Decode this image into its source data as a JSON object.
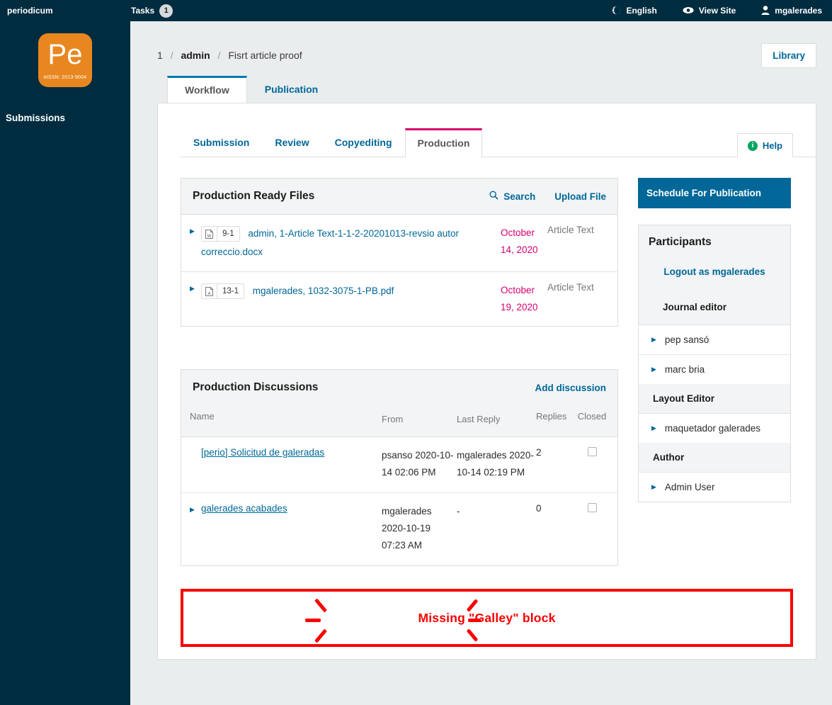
{
  "topbar": {
    "brand": "periodicum",
    "tasks_label": "Tasks",
    "tasks_count": "1",
    "language": "English",
    "language_icon": "globe-icon",
    "view_site": "View Site",
    "view_site_icon": "eye-icon",
    "user": "mgalerades",
    "user_icon": "user-icon"
  },
  "sidebar": {
    "logo_text": "Pe",
    "logo_issn": "eISSN: 2013-9004",
    "nav_label": "Submissions",
    "background": "#002c40",
    "logo_color": "#e8871f"
  },
  "breadcrumb": {
    "id": "1",
    "sep": "/",
    "owner": "admin",
    "title": "Fisrt article proof"
  },
  "library_button": "Library",
  "outer_tabs": [
    {
      "label": "Workflow",
      "active": true
    },
    {
      "label": "Publication",
      "active": false
    }
  ],
  "inner_tabs": [
    {
      "label": "Submission",
      "active": false
    },
    {
      "label": "Review",
      "active": false
    },
    {
      "label": "Copyediting",
      "active": false
    },
    {
      "label": "Production",
      "active": true
    }
  ],
  "help": {
    "label": "Help",
    "icon": "info-icon",
    "icon_color": "#00a65e"
  },
  "production_files": {
    "title": "Production Ready Files",
    "search_label": "Search",
    "search_icon": "search-icon",
    "upload_label": "Upload File",
    "rows": [
      {
        "file_icon": "word-doc-icon",
        "revision": "9-1",
        "name": "admin, 1-Article Text-1-1-2-20201013-revsio autor correccio.docx",
        "date": "October 14, 2020",
        "genre": "Article Text"
      },
      {
        "file_icon": "pdf-doc-icon",
        "revision": "13-1",
        "name": "mgalerades, 1032-3075-1-PB.pdf",
        "date": "October 19, 2020",
        "genre": "Article Text"
      }
    ]
  },
  "discussions": {
    "title": "Production Discussions",
    "add_label": "Add discussion",
    "columns": [
      "Name",
      "From",
      "Last Reply",
      "Replies",
      "Closed"
    ],
    "rows": [
      {
        "name": "[perio] Solicitud de galeradas",
        "from": "psanso 2020-10-14 02:06 PM",
        "last_reply": "mgalerades 2020-10-14 02:19 PM",
        "replies": "2",
        "closed": false,
        "has_arrow": false
      },
      {
        "name": "galerades acabades",
        "from": "mgalerades 2020-10-19 07:23 AM",
        "last_reply": "-",
        "replies": "0",
        "closed": false,
        "has_arrow": true
      }
    ]
  },
  "sidebar_right": {
    "schedule_button": "Schedule For Publication",
    "participants_title": "Participants",
    "logout_link": "Logout as mgalerades",
    "groups": [
      {
        "role": "Journal editor",
        "members": [
          "pep sansó",
          "marc bria"
        ]
      },
      {
        "role": "Layout Editor",
        "members": [
          "maquetador galerades"
        ]
      },
      {
        "role": "Author",
        "members": [
          "Admin User"
        ]
      }
    ]
  },
  "annotation": {
    "text": "Missing \"Galley\" block",
    "color": "#fb0000"
  }
}
